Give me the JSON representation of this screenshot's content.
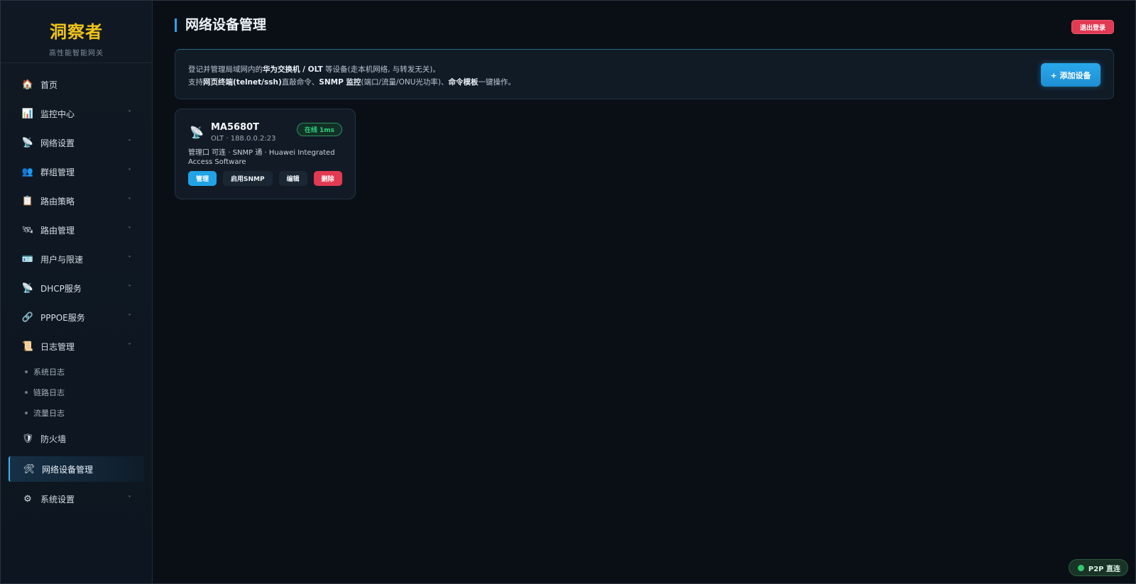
{
  "brand": {
    "title": "洞察者",
    "subtitle": "高性能智能网关"
  },
  "sidebar": {
    "items": [
      {
        "label": "首页",
        "icon": "home-icon",
        "glyph": "🏠",
        "chevron": false
      },
      {
        "label": "监控中心",
        "icon": "chart-icon",
        "glyph": "📊",
        "chevron": true
      },
      {
        "label": "网络设置",
        "icon": "satellite-dish-icon",
        "glyph": "📡",
        "chevron": true
      },
      {
        "label": "群组管理",
        "icon": "users-icon",
        "glyph": "👥",
        "chevron": true
      },
      {
        "label": "路由策略",
        "icon": "clipboard-icon",
        "glyph": "📋",
        "chevron": true
      },
      {
        "label": "路由管理",
        "icon": "satellite-icon",
        "glyph": "🛰",
        "chevron": true
      },
      {
        "label": "用户与限速",
        "icon": "id-card-icon",
        "glyph": "🪪",
        "chevron": true
      },
      {
        "label": "DHCP服务",
        "icon": "satellite-dish-icon",
        "glyph": "📡",
        "chevron": true
      },
      {
        "label": "PPPOE服务",
        "icon": "link-icon",
        "glyph": "🔗",
        "chevron": true
      },
      {
        "label": "日志管理",
        "icon": "scroll-icon",
        "glyph": "📜",
        "chevron": true
      },
      {
        "label": "防火墙",
        "icon": "shield-icon",
        "glyph": "🛡",
        "chevron": false
      },
      {
        "label": "网络设备管理",
        "icon": "tools-icon",
        "glyph": "🛠",
        "chevron": false
      },
      {
        "label": "系统设置",
        "icon": "gear-icon",
        "glyph": "⚙",
        "chevron": true
      }
    ],
    "log_subitems": [
      "系统日志",
      "链路日志",
      "流量日志"
    ],
    "chevron_glyph": "˅"
  },
  "header": {
    "title": "网络设备管理",
    "logout_label": "退出登录"
  },
  "info": {
    "line1_a": "登记并管理局域网内的",
    "line1_b": "华为交换机 / OLT",
    "line1_c": " 等设备(走本机网络, 与转发无关)。",
    "line2_a": "支持",
    "line2_b": "网页终端(telnet/ssh)",
    "line2_c": "直敲命令、",
    "line2_d": "SNMP 监控",
    "line2_e": "(端口/流量/ONU光功率)、",
    "line2_f": "命令模板",
    "line2_g": "一键操作。",
    "add_label": "+ 添加设备"
  },
  "device": {
    "name": "MA5680T",
    "meta": "OLT · 188.0.0.2:23",
    "status": "在线 1ms",
    "description": "管理口 可连 · SNMP 通 · Huawei Integrated Access Software",
    "actions": {
      "manage": "管理",
      "snmp": "启用SNMP",
      "edit": "编辑",
      "delete": "删除"
    }
  },
  "p2p": {
    "label": "P2P 直连"
  },
  "colors": {
    "accent": "#2ea3e8",
    "brand": "#f0c419",
    "danger": "#e13a52",
    "success": "#2fd07d"
  }
}
